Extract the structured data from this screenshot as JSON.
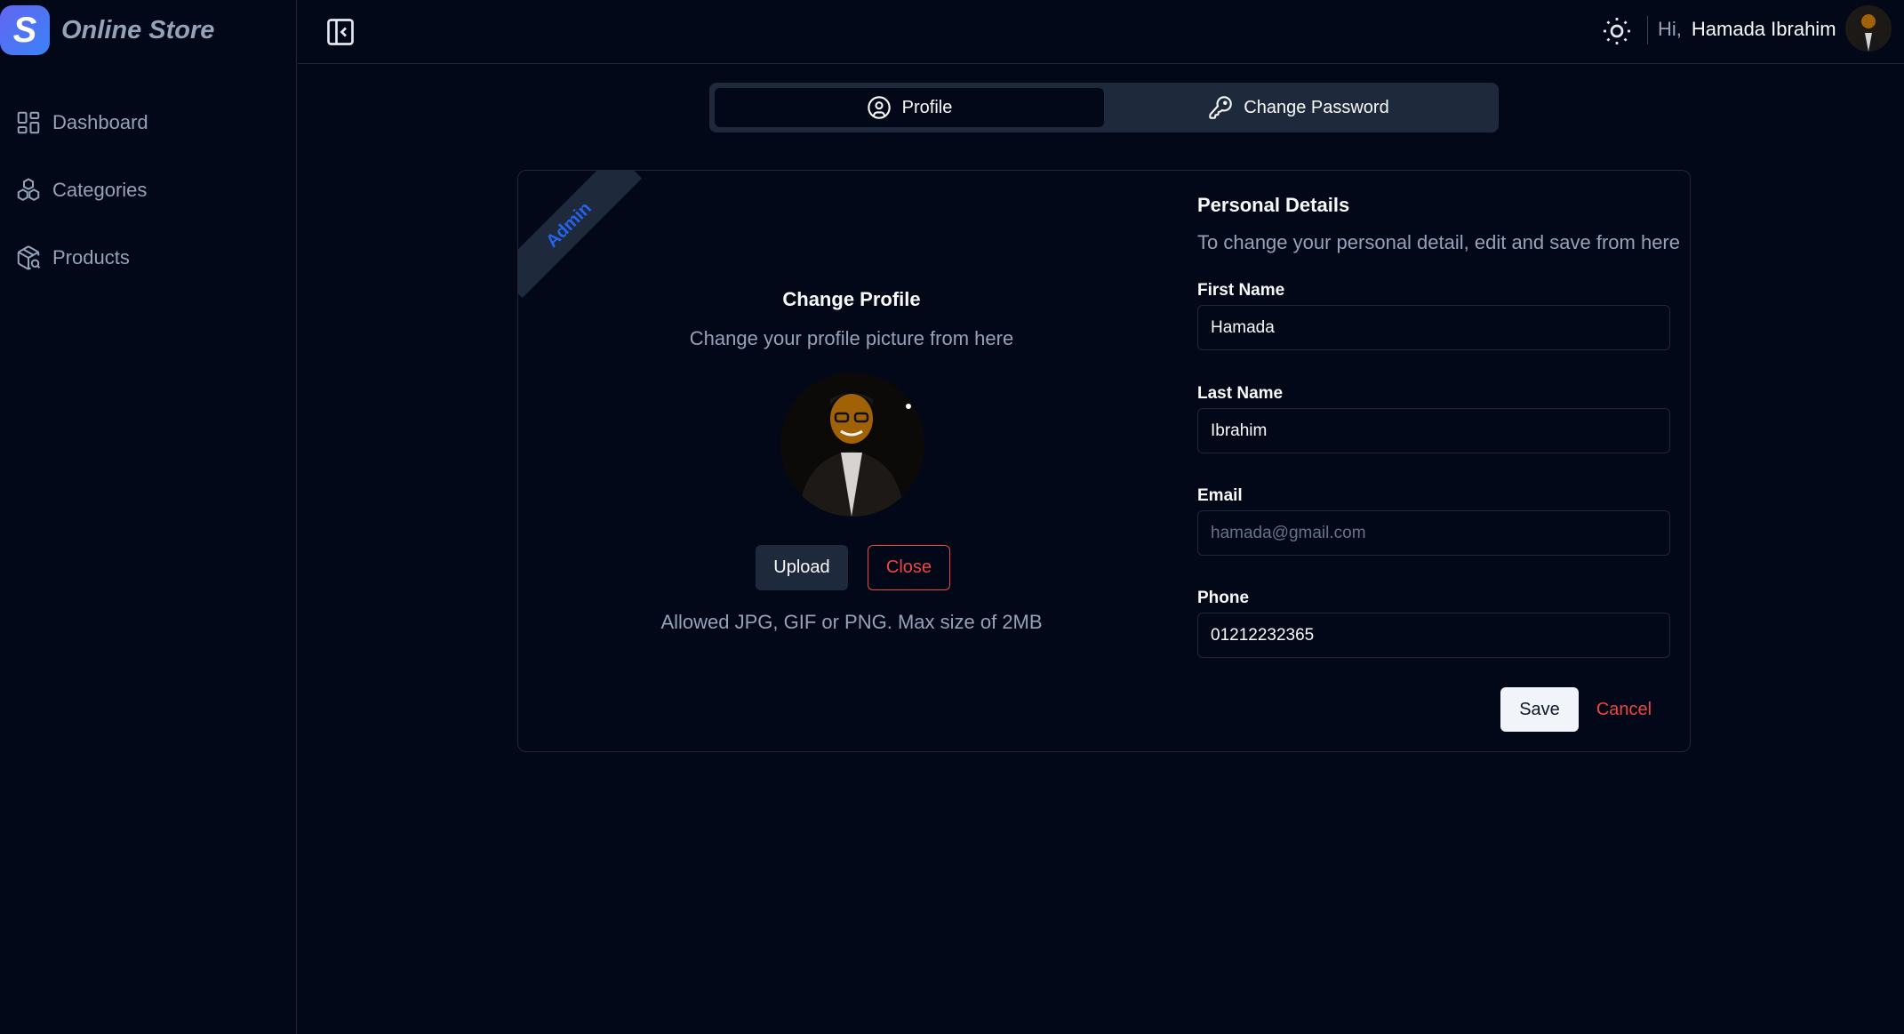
{
  "brand": {
    "name": "Online Store",
    "logo_letter": "S"
  },
  "sidebar": {
    "items": [
      {
        "label": "Dashboard",
        "icon": "dashboard-icon"
      },
      {
        "label": "Categories",
        "icon": "categories-icon"
      },
      {
        "label": "Products",
        "icon": "products-icon"
      }
    ]
  },
  "header": {
    "greeting": "Hi,",
    "user_name": "Hamada Ibrahim",
    "icons": [
      "sidebar-collapse-icon",
      "sun-icon",
      "avatar"
    ]
  },
  "tabs": [
    {
      "label": "Profile",
      "icon": "user-circle-icon",
      "active": true
    },
    {
      "label": "Change Password",
      "icon": "key-icon",
      "active": false
    }
  ],
  "profile_card": {
    "ribbon": "Admin",
    "title": "Change Profile",
    "subtitle": "Change your profile picture from here",
    "upload_label": "Upload",
    "close_label": "Close",
    "allowed_text": "Allowed JPG, GIF or PNG. Max size of 2MB"
  },
  "personal_details": {
    "title": "Personal Details",
    "subtitle": "To change your personal detail, edit and save from here",
    "first_name": {
      "label": "First Name",
      "value": "Hamada"
    },
    "last_name": {
      "label": "Last Name",
      "value": "Ibrahim"
    },
    "email": {
      "label": "Email",
      "value": "",
      "placeholder": "hamada@gmail.com"
    },
    "phone": {
      "label": "Phone",
      "value": "01212232365"
    },
    "save_label": "Save",
    "cancel_label": "Cancel"
  },
  "colors": {
    "background": "#020817",
    "border": "#1e293b",
    "muted_text": "#94a3b8",
    "danger": "#ef4444",
    "ribbon_text": "#2563eb",
    "brand_gradient_start": "#6366f1",
    "brand_gradient_end": "#3b82f6"
  }
}
